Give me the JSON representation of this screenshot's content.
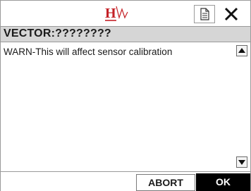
{
  "header": {
    "logo_icon": "hw-logo-icon",
    "logo_colors": {
      "red": "#c42026",
      "gray": "#8a8a8a"
    },
    "document_icon": "document-icon",
    "close_icon": "close-x-icon"
  },
  "dialog": {
    "title": "VECTOR:????????",
    "message": "WARN-This will affect sensor calibration"
  },
  "scrollbar": {
    "up_icon": "scroll-up-arrow-icon",
    "down_icon": "scroll-down-arrow-icon"
  },
  "buttons": {
    "abort_label": "ABORT",
    "ok_label": "OK"
  },
  "colors": {
    "title_bar_bg": "#d6d6d6",
    "ok_bg": "#000000",
    "ok_text": "#ffffff",
    "border": "#9a9a9a"
  }
}
